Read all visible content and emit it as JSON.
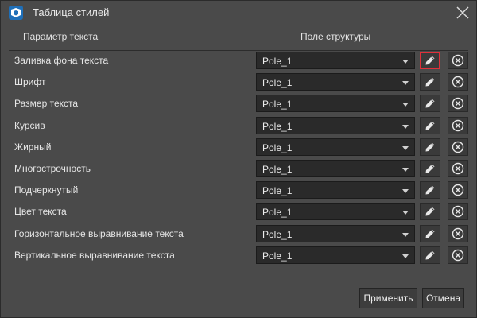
{
  "window": {
    "title": "Таблица стилей"
  },
  "columns": {
    "param_header": "Параметр текста",
    "field_header": "Поле структуры"
  },
  "rows": [
    {
      "label": "Заливка фона текста",
      "value": "Pole_1"
    },
    {
      "label": "Шрифт",
      "value": "Pole_1"
    },
    {
      "label": "Размер текста",
      "value": "Pole_1"
    },
    {
      "label": "Курсив",
      "value": "Pole_1"
    },
    {
      "label": "Жирный",
      "value": "Pole_1"
    },
    {
      "label": "Многострочность",
      "value": "Pole_1"
    },
    {
      "label": "Подчеркнутый",
      "value": "Pole_1"
    },
    {
      "label": "Цвет текста",
      "value": "Pole_1"
    },
    {
      "label": "Горизонтальное выравнивание текста",
      "value": "Pole_1"
    },
    {
      "label": "Вертикальное выравнивание текста",
      "value": "Pole_1"
    }
  ],
  "highlighted_edit_row": 0,
  "footer": {
    "apply_label": "Применить",
    "cancel_label": "Отмена"
  },
  "colors": {
    "background": "#4a4a4a",
    "field_background": "#2a2a2a",
    "highlight": "#e0303a"
  }
}
